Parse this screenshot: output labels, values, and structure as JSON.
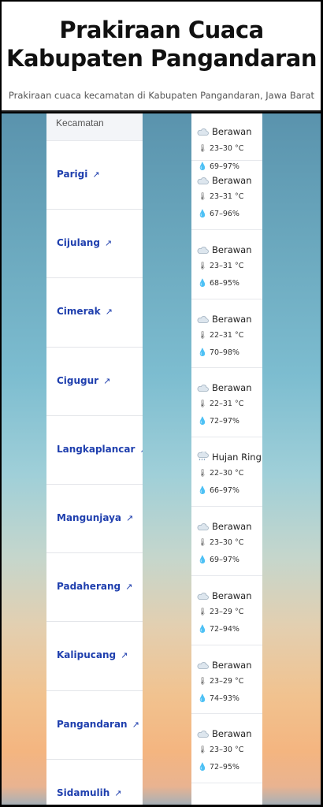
{
  "header": {
    "title": "Prakiraan Cuaca Kabupaten Pangandaran",
    "subtitle": "Prakiraan cuaca kecamatan di Kabupaten Pangandaran, Jawa Barat"
  },
  "table": {
    "column_header": "Kecamatan",
    "rows": [
      {
        "name": "Parigi"
      },
      {
        "name": "Cijulang"
      },
      {
        "name": "Cimerak"
      },
      {
        "name": "Cigugur"
      },
      {
        "name": "Langkaplancar"
      },
      {
        "name": "Mangunjaya"
      },
      {
        "name": "Padaherang"
      },
      {
        "name": "Kalipucang"
      },
      {
        "name": "Pangandaran"
      },
      {
        "name": "Sidamulih"
      }
    ]
  },
  "weather": [
    {
      "condition": "Berawan",
      "temp": "23–30 °C",
      "humidity": "69–97%"
    },
    {
      "condition": "Berawan",
      "temp": "23–31 °C",
      "humidity": "67–96%"
    },
    {
      "condition": "Berawan",
      "temp": "23–31 °C",
      "humidity": "68–95%"
    },
    {
      "condition": "Berawan",
      "temp": "22–31 °C",
      "humidity": "70–98%"
    },
    {
      "condition": "Berawan",
      "temp": "22–31 °C",
      "humidity": "72–97%"
    },
    {
      "condition": "Hujan Ring",
      "temp": "22–30 °C",
      "humidity": "66–97%"
    },
    {
      "condition": "Berawan",
      "temp": "23–30 °C",
      "humidity": "69–97%"
    },
    {
      "condition": "Berawan",
      "temp": "23–29 °C",
      "humidity": "72–94%"
    },
    {
      "condition": "Berawan",
      "temp": "23–29 °C",
      "humidity": "74–93%"
    },
    {
      "condition": "Berawan",
      "temp": "23–30 °C",
      "humidity": "72–95%"
    }
  ],
  "icons": {
    "link": "external-link-arrow",
    "cloud": "cloud-icon",
    "rain": "cloud-rain-icon",
    "temperature": "thermometer-icon",
    "humidity": "droplet-icon"
  },
  "colors": {
    "link": "#1f3fae",
    "cloud": "#b9c7d2"
  }
}
